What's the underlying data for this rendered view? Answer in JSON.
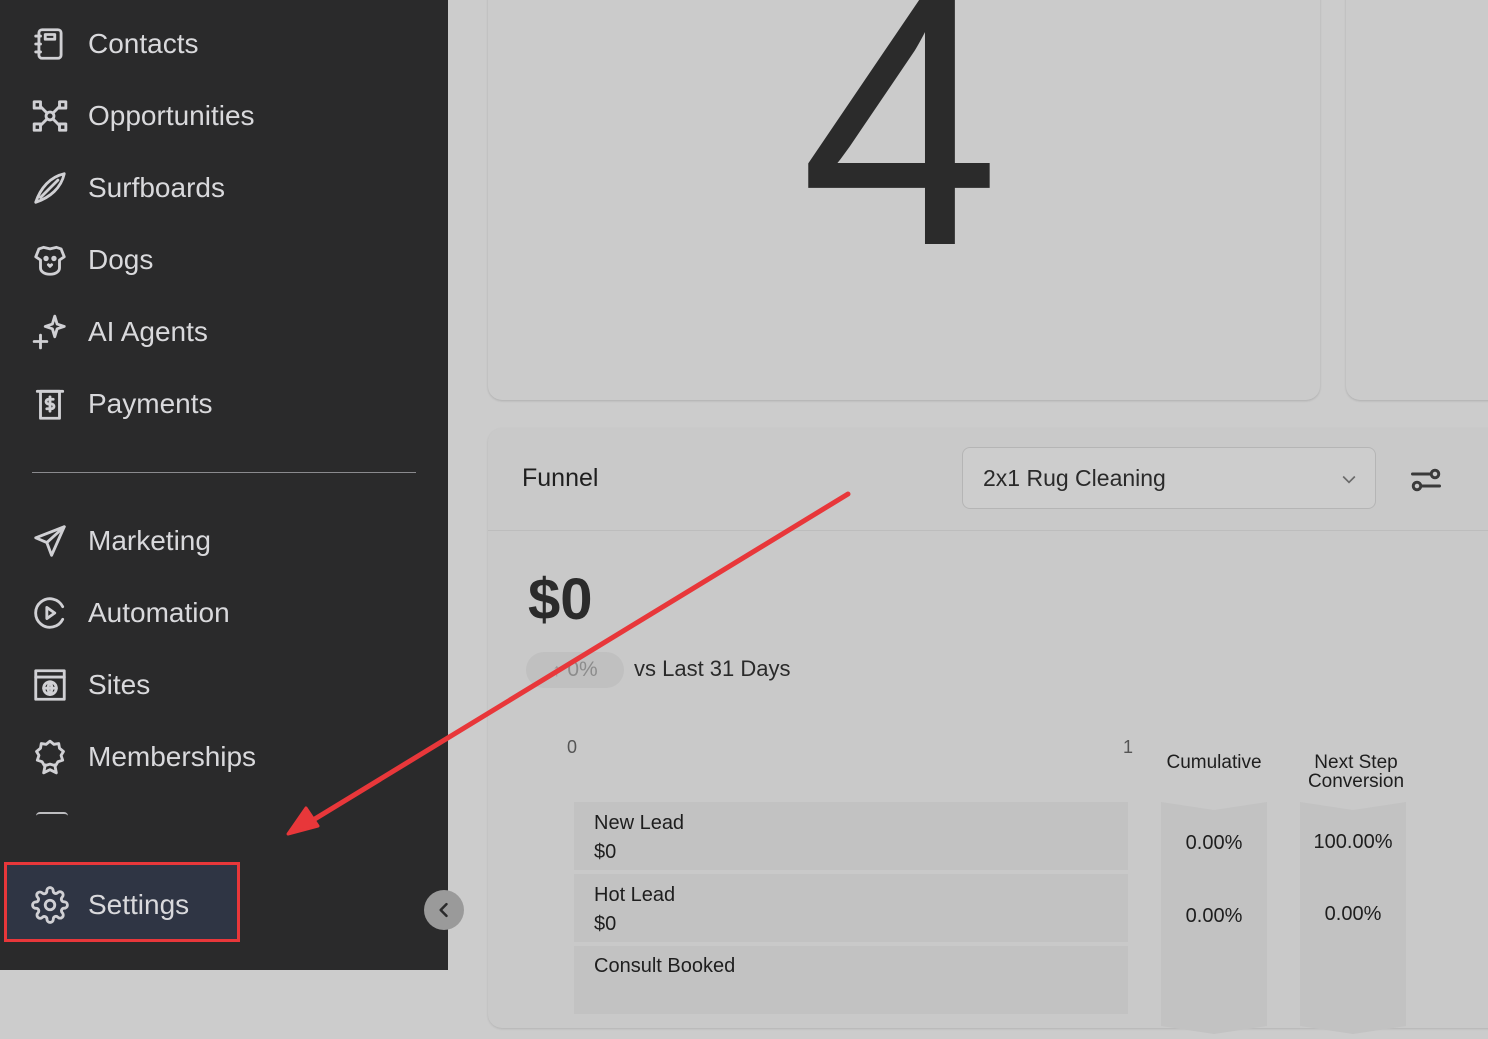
{
  "sidebar": {
    "items": [
      {
        "label": "Contacts",
        "icon": "contacts-book-icon"
      },
      {
        "label": "Opportunities",
        "icon": "opportunities-network-icon"
      },
      {
        "label": "Surfboards",
        "icon": "surfboard-icon"
      },
      {
        "label": "Dogs",
        "icon": "dog-icon"
      },
      {
        "label": "AI Agents",
        "icon": "sparkle-plus-icon"
      },
      {
        "label": "Payments",
        "icon": "receipt-dollar-icon"
      }
    ],
    "items2": [
      {
        "label": "Marketing",
        "icon": "paper-plane-icon"
      },
      {
        "label": "Automation",
        "icon": "play-circle-icon"
      },
      {
        "label": "Sites",
        "icon": "globe-window-icon"
      },
      {
        "label": "Memberships",
        "icon": "award-badge-icon"
      }
    ],
    "settings_label": "Settings"
  },
  "main": {
    "big_number": "4",
    "funnel": {
      "title": "Funnel",
      "selected_pipeline": "2x1 Rug Cleaning",
      "total_amount": "$0",
      "change_pct": "0%",
      "comparison": "vs Last 31 Days",
      "axis_min": "0",
      "axis_max": "1",
      "col_cumulative": "Cumulative",
      "col_next_step_1": "Next Step",
      "col_next_step_2": "Conversion",
      "stages": [
        {
          "name": "New Lead",
          "value": "$0",
          "cumulative": "0.00%",
          "next_step": "100.00%"
        },
        {
          "name": "Hot Lead",
          "value": "$0",
          "cumulative": "0.00%",
          "next_step": "0.00%"
        },
        {
          "name": "Consult Booked",
          "value": "",
          "cumulative": "",
          "next_step": ""
        }
      ]
    }
  },
  "colors": {
    "sidebar_bg": "#2a2a2b",
    "highlight": "#e8373a",
    "main_bg": "#cccccc"
  }
}
